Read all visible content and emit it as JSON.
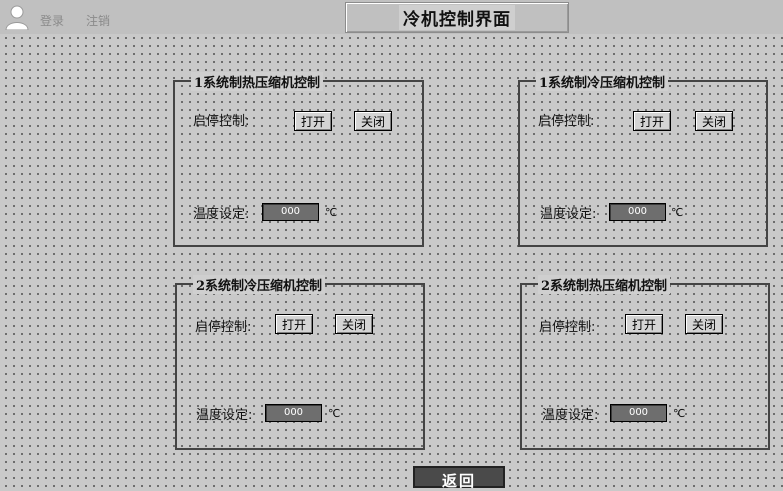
{
  "header": {
    "login_label": "登录",
    "logout_label": "注销",
    "title": "冷机控制界面"
  },
  "panels": [
    {
      "title": "1系统制热压缩机控制",
      "start_stop_label": "启停控制:",
      "open_label": "打开",
      "close_label": "关闭",
      "temp_label": "温度设定:",
      "temp_value": "000",
      "temp_unit": "℃"
    },
    {
      "title": "1系统制冷压缩机控制",
      "start_stop_label": "启停控制:",
      "open_label": "打开",
      "close_label": "关闭",
      "temp_label": "温度设定:",
      "temp_value": "000",
      "temp_unit": "℃"
    },
    {
      "title": "2系统制冷压缩机控制",
      "start_stop_label": "启停控制:",
      "open_label": "打开",
      "close_label": "关闭",
      "temp_label": "温度设定:",
      "temp_value": "000",
      "temp_unit": "℃"
    },
    {
      "title": "2系统制热压缩机控制",
      "start_stop_label": "启停控制:",
      "open_label": "打开",
      "close_label": "关闭",
      "temp_label": "温度设定:",
      "temp_value": "000",
      "temp_unit": "℃"
    }
  ],
  "footer": {
    "return_label": "返回"
  }
}
